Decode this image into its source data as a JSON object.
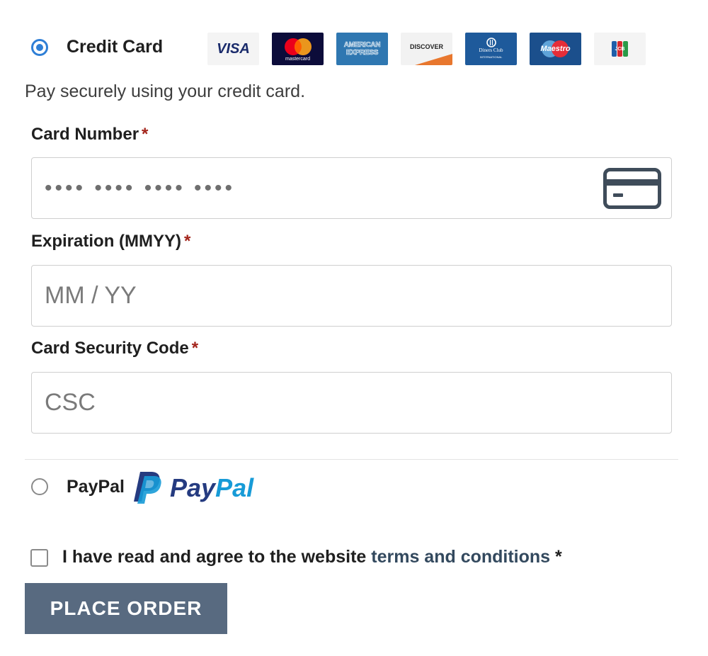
{
  "payment_methods": {
    "credit_card": {
      "label": "Credit Card",
      "selected": true,
      "description": "Pay securely using your credit card.",
      "card_brands": [
        "visa-logo",
        "mastercard-logo",
        "american-express-logo",
        "discover-logo",
        "diners-club-logo",
        "maestro-logo",
        "jcb-logo"
      ],
      "logo_text": {
        "visa": "VISA",
        "mastercard": "mastercard",
        "amex_line1": "AMERICAN",
        "amex_line2": "EXPRESS",
        "discover": "DISCOVER",
        "diners": "Diners Club",
        "diners_sub": "INTERNATIONAL",
        "maestro": "Maestro",
        "jcb": "JCB"
      }
    },
    "paypal": {
      "label": "PayPal",
      "selected": false,
      "brand_text_part1": "Pay",
      "brand_text_part2": "Pal"
    }
  },
  "fields": {
    "card_number": {
      "label": "Card Number",
      "required_mark": "*",
      "placeholder": "•••• •••• •••• ••••",
      "value": "",
      "icon": "credit-card-icon"
    },
    "expiration": {
      "label": "Expiration (MMYY)",
      "required_mark": "*",
      "placeholder": "MM / YY",
      "value": ""
    },
    "security_code": {
      "label": "Card Security Code",
      "required_mark": "*",
      "placeholder": "CSC",
      "value": ""
    }
  },
  "terms": {
    "text": "I have read and agree to the website ",
    "link_text": "terms and conditions",
    "required_mark": "*",
    "checked": false
  },
  "place_order": {
    "label": "PLACE ORDER"
  },
  "colors": {
    "radio_selected": "#2f7fd6",
    "required": "#a3241b",
    "link": "#33495e",
    "button_bg": "#586a80",
    "paypal_dark": "#253b80",
    "paypal_light": "#179bd7"
  }
}
